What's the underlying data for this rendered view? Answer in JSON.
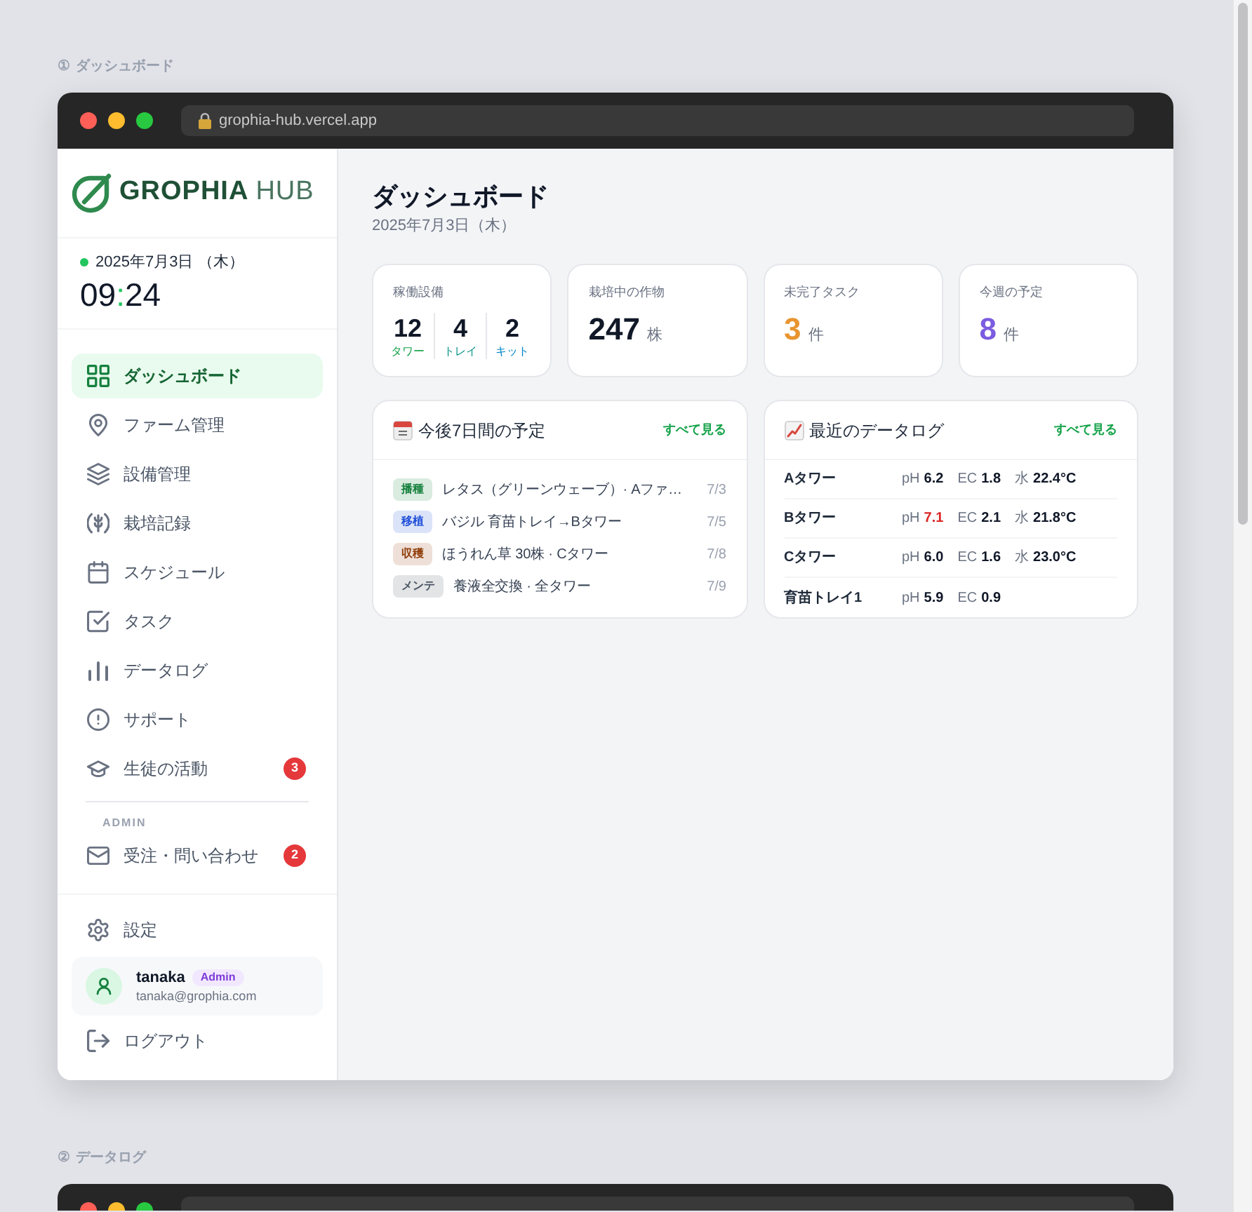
{
  "sections": [
    {
      "number": "①",
      "label": "ダッシュボード",
      "browser": {
        "url": "grophia-hub.vercel.app"
      },
      "sidebar": {
        "logo": {
          "brand": "GROPHIA",
          "suffix": "HUB"
        },
        "clock": {
          "date": "2025年7月3日 （木）",
          "hours": "09",
          "separator": ":",
          "minutes": "24"
        },
        "nav": [
          {
            "label": "ダッシュボード",
            "selected": true
          },
          {
            "label": "ファーム管理",
            "selected": false
          },
          {
            "label": "設備管理",
            "selected": false
          },
          {
            "label": "栽培記録",
            "selected": false
          },
          {
            "label": "スケジュール",
            "selected": false
          },
          {
            "label": "タスク",
            "selected": false
          },
          {
            "label": "データログ",
            "selected": false
          },
          {
            "label": "サポート",
            "selected": false
          },
          {
            "label": "生徒の活動",
            "selected": false,
            "badge": "3"
          }
        ],
        "admin": {
          "heading": "ADMIN",
          "items": [
            {
              "label": "受注・問い合わせ",
              "selected": false,
              "badge": "2"
            }
          ]
        },
        "settings": {
          "label": "設定"
        },
        "user": {
          "name": "tanaka",
          "role": "Admin",
          "email": "tanaka@grophia.com"
        },
        "logout": {
          "label": "ログアウト"
        }
      },
      "main": {
        "title": "ダッシュボード",
        "date": "2025年7月3日（木）",
        "stats": [
          {
            "kind": "breakdown",
            "label": "稼働設備",
            "parts": [
              {
                "value": "12",
                "label": "タワー",
                "color": "#16a34a"
              },
              {
                "value": "4",
                "label": "トレイ",
                "color": "#0d9488"
              },
              {
                "value": "2",
                "label": "キット",
                "color": "#0284c7"
              }
            ]
          },
          {
            "kind": "count",
            "label": "栽培中の作物",
            "value": "247",
            "unit": "株",
            "color": "#111827"
          },
          {
            "kind": "count",
            "label": "未完了タスク",
            "value": "3",
            "unit": "件",
            "color": "#e8952f"
          },
          {
            "kind": "count",
            "label": "今週の予定",
            "value": "8",
            "unit": "件",
            "color": "#7c5ce0"
          }
        ],
        "schedule": {
          "title": "今後7日間の予定",
          "link": "すべて見る",
          "items": [
            {
              "tag": "播種",
              "color": "#15803d",
              "text": "レタス（グリーンウェーブ）· Aファ…",
              "date": "7/3"
            },
            {
              "tag": "移植",
              "color": "#1d4ed8",
              "text": "バジル 育苗トレイ→Bタワー",
              "date": "7/5"
            },
            {
              "tag": "収穫",
              "color": "#92400e",
              "text": "ほうれん草 30株 · Cタワー",
              "date": "7/8"
            },
            {
              "tag": "メンテ",
              "color": "#4b5563",
              "text": "養液全交換 · 全タワー",
              "date": "7/9"
            }
          ]
        },
        "datalog": {
          "title": "最近のデータログ",
          "link": "すべて見る",
          "rows": [
            {
              "name": "Aタワー",
              "readings": [
                {
                  "label": "pH",
                  "value": "6.2",
                  "alert": false
                },
                {
                  "label": "EC",
                  "value": "1.8",
                  "alert": false
                },
                {
                  "label": "水",
                  "value": "22.4°C",
                  "alert": false
                }
              ]
            },
            {
              "name": "Bタワー",
              "readings": [
                {
                  "label": "pH",
                  "value": "7.1",
                  "alert": true
                },
                {
                  "label": "EC",
                  "value": "2.1",
                  "alert": false
                },
                {
                  "label": "水",
                  "value": "21.8°C",
                  "alert": false
                }
              ]
            },
            {
              "name": "Cタワー",
              "readings": [
                {
                  "label": "pH",
                  "value": "6.0",
                  "alert": false
                },
                {
                  "label": "EC",
                  "value": "1.6",
                  "alert": false
                },
                {
                  "label": "水",
                  "value": "23.0°C",
                  "alert": false
                }
              ]
            },
            {
              "name": "育苗トレイ1",
              "readings": [
                {
                  "label": "pH",
                  "value": "5.9",
                  "alert": false
                },
                {
                  "label": "EC",
                  "value": "0.9",
                  "alert": false
                }
              ]
            }
          ]
        }
      }
    },
    {
      "number": "②",
      "label": "データログ"
    }
  ]
}
